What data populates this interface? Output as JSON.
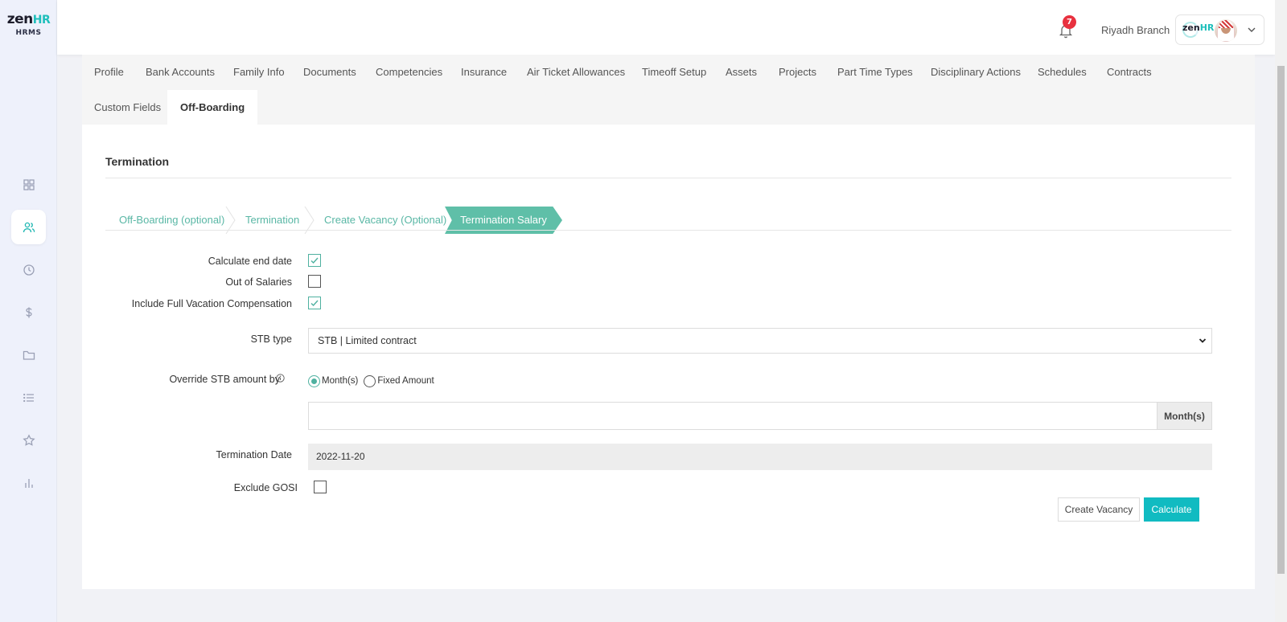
{
  "app": {
    "logo_word": "zen",
    "logo_hr": "HR",
    "logo_sub": "HRMS"
  },
  "sidebar": {
    "items": [
      {
        "icon": "dashboard-icon"
      },
      {
        "icon": "users-icon",
        "active": true
      },
      {
        "icon": "clock-icon"
      },
      {
        "icon": "dollar-icon"
      },
      {
        "icon": "folder-icon"
      },
      {
        "icon": "list-icon"
      },
      {
        "icon": "star-icon"
      },
      {
        "icon": "bar-chart-icon"
      }
    ]
  },
  "topbar": {
    "notification_count": "7",
    "branch": "Riyadh Branch",
    "profile_logo_word": "zen",
    "profile_logo_hr": "HR"
  },
  "tabs": [
    {
      "label": "Profile"
    },
    {
      "label": "Bank Accounts"
    },
    {
      "label": "Family Info"
    },
    {
      "label": "Documents"
    },
    {
      "label": "Competencies"
    },
    {
      "label": "Insurance"
    },
    {
      "label": "Air Ticket Allowances"
    },
    {
      "label": "Timeoff Setup"
    },
    {
      "label": "Assets"
    },
    {
      "label": "Projects"
    },
    {
      "label": "Part Time Types"
    },
    {
      "label": "Disciplinary Actions"
    },
    {
      "label": "Schedules"
    },
    {
      "label": "Contracts"
    },
    {
      "label": "Custom Fields"
    },
    {
      "label": "Off-Boarding",
      "active": true
    }
  ],
  "section": {
    "title": "Termination"
  },
  "steps": [
    {
      "label": "Off-Boarding (optional)"
    },
    {
      "label": "Termination"
    },
    {
      "label": "Create Vacancy (Optional)"
    },
    {
      "label": "Termination Salary",
      "active": true
    }
  ],
  "form": {
    "calculate_end_date": {
      "label": "Calculate end date",
      "checked": true
    },
    "out_of_salaries": {
      "label": "Out of Salaries",
      "checked": false
    },
    "include_full_vacation": {
      "label": "Include Full Vacation Compensation",
      "checked": true
    },
    "stb_type": {
      "label": "STB type",
      "value": "STB | Limited contract"
    },
    "override_stb": {
      "label": "Override STB amount by",
      "options": [
        {
          "label": "Month(s)",
          "selected": true
        },
        {
          "label": "Fixed Amount",
          "selected": false
        }
      ],
      "input_value": "",
      "addon": "Month(s)"
    },
    "termination_date": {
      "label": "Termination Date",
      "value": "2022-11-20"
    },
    "exclude_gosi": {
      "label": "Exclude GOSI",
      "checked": false
    }
  },
  "buttons": {
    "create_vacancy": "Create Vacancy",
    "calculate": "Calculate"
  },
  "colors": {
    "accent": "#11bbc1",
    "step_active": "#5fbfa8",
    "step_text": "#59b7a5",
    "badge": "#e8313f"
  }
}
